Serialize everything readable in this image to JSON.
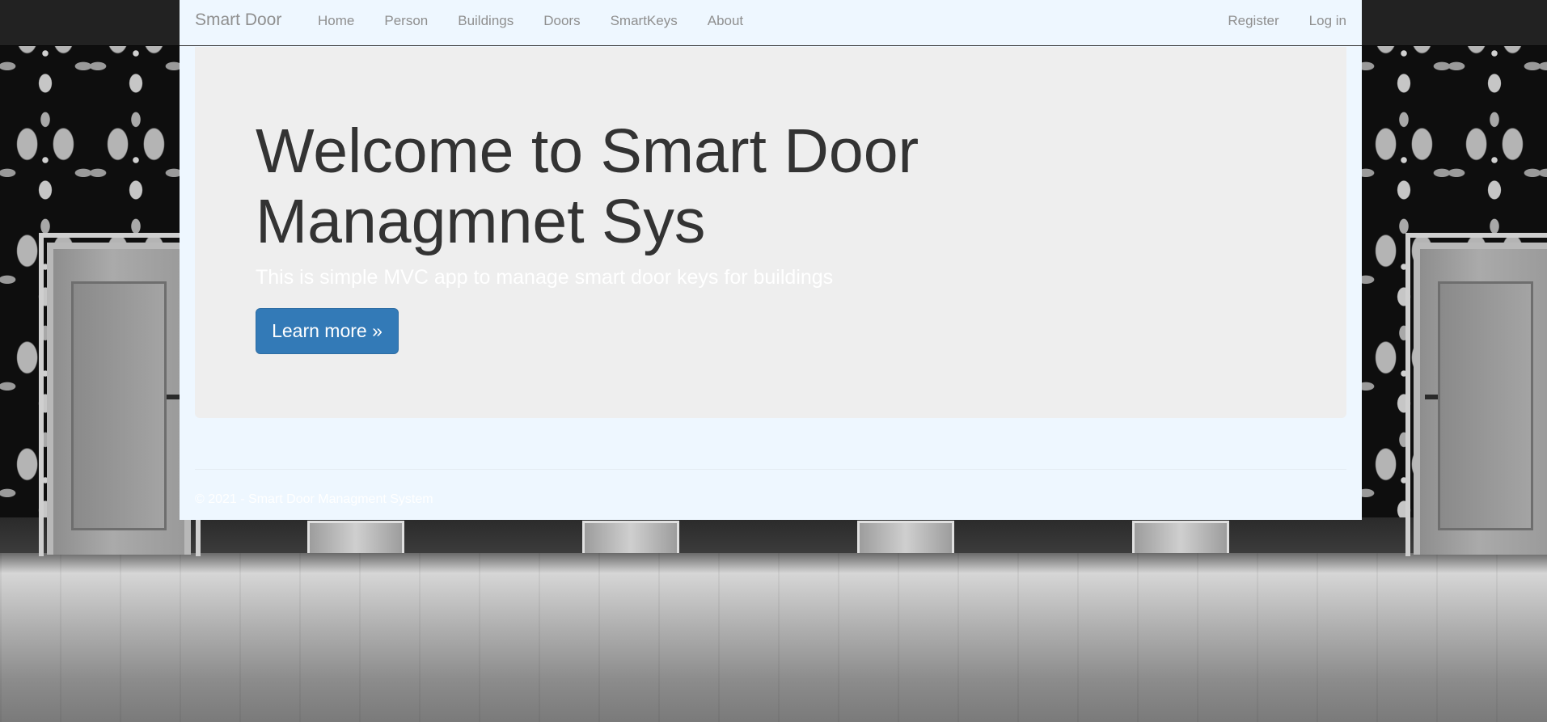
{
  "nav": {
    "brand": "Smart Door",
    "left_items": [
      {
        "label": "Home"
      },
      {
        "label": "Person"
      },
      {
        "label": "Buildings"
      },
      {
        "label": "Doors"
      },
      {
        "label": "SmartKeys"
      },
      {
        "label": "About"
      }
    ],
    "right_items": [
      {
        "label": "Register"
      },
      {
        "label": "Log in"
      }
    ]
  },
  "jumbotron": {
    "title": "Welcome to Smart Door Managmnet Sys",
    "lead": "This is simple MVC app to manage smart door keys for buildings",
    "button_label": "Learn more »"
  },
  "footer": {
    "text": "© 2021 - Smart Door Managment System"
  },
  "colors": {
    "container_bg": "#eef7ff",
    "jumbotron_bg": "#eeeeee",
    "primary_button": "#337ab7",
    "nav_text": "#8f8f8f",
    "top_bar": "#222222"
  }
}
